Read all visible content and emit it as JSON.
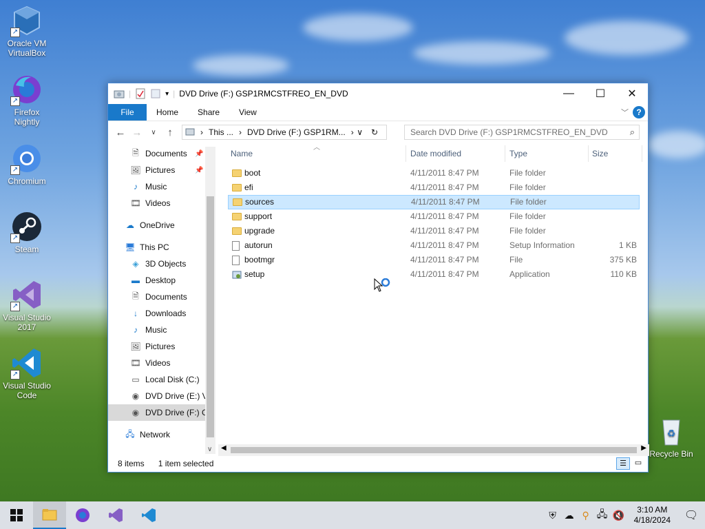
{
  "desktop": {
    "icons": [
      {
        "label": "Oracle VM VirtualBox"
      },
      {
        "label": "Firefox Nightly"
      },
      {
        "label": "Chromium"
      },
      {
        "label": "Steam"
      },
      {
        "label": "Visual Studio 2017"
      },
      {
        "label": "Visual Studio Code"
      },
      {
        "label": "Recycle Bin"
      }
    ]
  },
  "window": {
    "title": "DVD Drive (F:) GSP1RMCSTFREO_EN_DVD",
    "ribbon_tabs": [
      "File",
      "Home",
      "Share",
      "View"
    ],
    "help_label": "?",
    "address": {
      "crumbs": [
        "This ...",
        "DVD Drive (F:) GSP1RM..."
      ]
    },
    "search_placeholder": "Search DVD Drive (F:) GSP1RMCSTFREO_EN_DVD",
    "nav": [
      {
        "label": "Documents",
        "icon": "documents-icon",
        "pinned": true
      },
      {
        "label": "Pictures",
        "icon": "pictures-icon",
        "pinned": true
      },
      {
        "label": "Music",
        "icon": "music-icon"
      },
      {
        "label": "Videos",
        "icon": "videos-icon"
      },
      {
        "label": "OneDrive",
        "icon": "onedrive-icon"
      },
      {
        "label": "This PC",
        "icon": "this-pc-icon"
      },
      {
        "label": "3D Objects",
        "icon": "3d-objects-icon"
      },
      {
        "label": "Desktop",
        "icon": "desktop-icon"
      },
      {
        "label": "Documents",
        "icon": "documents-icon"
      },
      {
        "label": "Downloads",
        "icon": "downloads-icon"
      },
      {
        "label": "Music",
        "icon": "music-icon"
      },
      {
        "label": "Pictures",
        "icon": "pictures-icon"
      },
      {
        "label": "Videos",
        "icon": "videos-icon"
      },
      {
        "label": "Local Disk (C:)",
        "icon": "local-disk-icon"
      },
      {
        "label": "DVD Drive (E:) Vi",
        "icon": "dvd-drive-icon"
      },
      {
        "label": "DVD Drive (F:) GS",
        "icon": "dvd-drive-icon",
        "selected": true
      },
      {
        "label": "Network",
        "icon": "network-icon"
      }
    ],
    "columns": [
      "Name",
      "Date modified",
      "Type",
      "Size"
    ],
    "files": [
      {
        "name": "boot",
        "date": "4/11/2011 8:47 PM",
        "type": "File folder",
        "size": "",
        "kind": "folder"
      },
      {
        "name": "efi",
        "date": "4/11/2011 8:47 PM",
        "type": "File folder",
        "size": "",
        "kind": "folder"
      },
      {
        "name": "sources",
        "date": "4/11/2011 8:47 PM",
        "type": "File folder",
        "size": "",
        "kind": "folder",
        "selected": true
      },
      {
        "name": "support",
        "date": "4/11/2011 8:47 PM",
        "type": "File folder",
        "size": "",
        "kind": "folder"
      },
      {
        "name": "upgrade",
        "date": "4/11/2011 8:47 PM",
        "type": "File folder",
        "size": "",
        "kind": "folder"
      },
      {
        "name": "autorun",
        "date": "4/11/2011 8:47 PM",
        "type": "Setup Information",
        "size": "1 KB",
        "kind": "file"
      },
      {
        "name": "bootmgr",
        "date": "4/11/2011 8:47 PM",
        "type": "File",
        "size": "375 KB",
        "kind": "file"
      },
      {
        "name": "setup",
        "date": "4/11/2011 8:47 PM",
        "type": "Application",
        "size": "110 KB",
        "kind": "app"
      }
    ],
    "status": {
      "items": "8 items",
      "selected": "1 item selected"
    }
  },
  "taskbar": {
    "time": "3:10 AM",
    "date": "4/18/2024"
  },
  "colors": {
    "accent": "#1979ca",
    "selection": "#cce8ff"
  }
}
